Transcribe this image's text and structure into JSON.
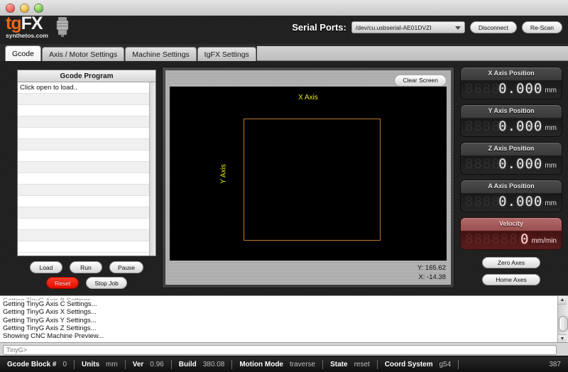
{
  "window": {
    "traffic_lights": [
      "close",
      "minimize",
      "zoom"
    ]
  },
  "header": {
    "logo_tg": "tg",
    "logo_fx": "FX",
    "logo_subtitle": "synthetos.com",
    "serial_label": "Serial Ports:",
    "serial_port_value": "/dev/cu.usbserial-AE01DVZI",
    "disconnect_label": "Disconnect",
    "rescan_label": "Re-Scan"
  },
  "tabs": [
    {
      "label": "Gcode",
      "active": true
    },
    {
      "label": "Axis / Motor Settings",
      "active": false
    },
    {
      "label": "Machine Settings",
      "active": false
    },
    {
      "label": "tgFX Settings",
      "active": false
    }
  ],
  "gcode_panel": {
    "title": "Gcode Program",
    "rows": [
      "Click open to load..",
      "",
      "",
      "",
      "",
      "",
      "",
      "",
      "",
      "",
      "",
      "",
      "",
      "",
      ""
    ],
    "buttons_row1": [
      "Load",
      "Run",
      "Pause"
    ],
    "buttons_row2": [
      "Reset",
      "Stop Job"
    ]
  },
  "preview": {
    "clear_label": "Clear Screen",
    "x_axis_label": "X Axis",
    "y_axis_label": "Y Axis",
    "readout_y": "Y: 165.62",
    "readout_x": "X: -14.38",
    "outline_color": "#c0762f",
    "axis_label_color": "#e8e80d"
  },
  "dro": {
    "items": [
      {
        "title": "X Axis Position",
        "value": "0.000",
        "unit": "mm",
        "ghost": "8888"
      },
      {
        "title": "Y Axis Position",
        "value": "0.000",
        "unit": "mm",
        "ghost": "8888"
      },
      {
        "title": "Z Axis Position",
        "value": "0.000",
        "unit": "mm",
        "ghost": "8888"
      },
      {
        "title": "A Axis Position",
        "value": "0.000",
        "unit": "mm",
        "ghost": "8888"
      }
    ],
    "velocity": {
      "title": "Velocity",
      "value": "0",
      "unit": "mm/min",
      "ghost": "888888",
      "color": "#a04a4a"
    },
    "zero_axes_label": "Zero Axes",
    "home_axes_label": "Home Axes"
  },
  "console": {
    "lines": [
      "Getting TinyG Axis B Settings...",
      "Getting TinyG Axis C Settings...",
      "Getting TinyG Axis X Settings...",
      "Getting TinyG Axis Y Settings...",
      "Getting TinyG Axis Z Settings...",
      "Showing CNC Machine Preview..."
    ]
  },
  "command": {
    "placeholder": "TinyG>",
    "value": ""
  },
  "statusbar": {
    "fields": [
      {
        "key": "Gcode Block #",
        "value": "0"
      },
      {
        "key": "Units",
        "value": "mm"
      },
      {
        "key": "Ver",
        "value": "0.96"
      },
      {
        "key": "Build",
        "value": "380.08"
      },
      {
        "key": "Motion Mode",
        "value": "traverse"
      },
      {
        "key": "State",
        "value": "reset"
      },
      {
        "key": "Coord System",
        "value": "g54"
      }
    ],
    "counter": "387"
  }
}
